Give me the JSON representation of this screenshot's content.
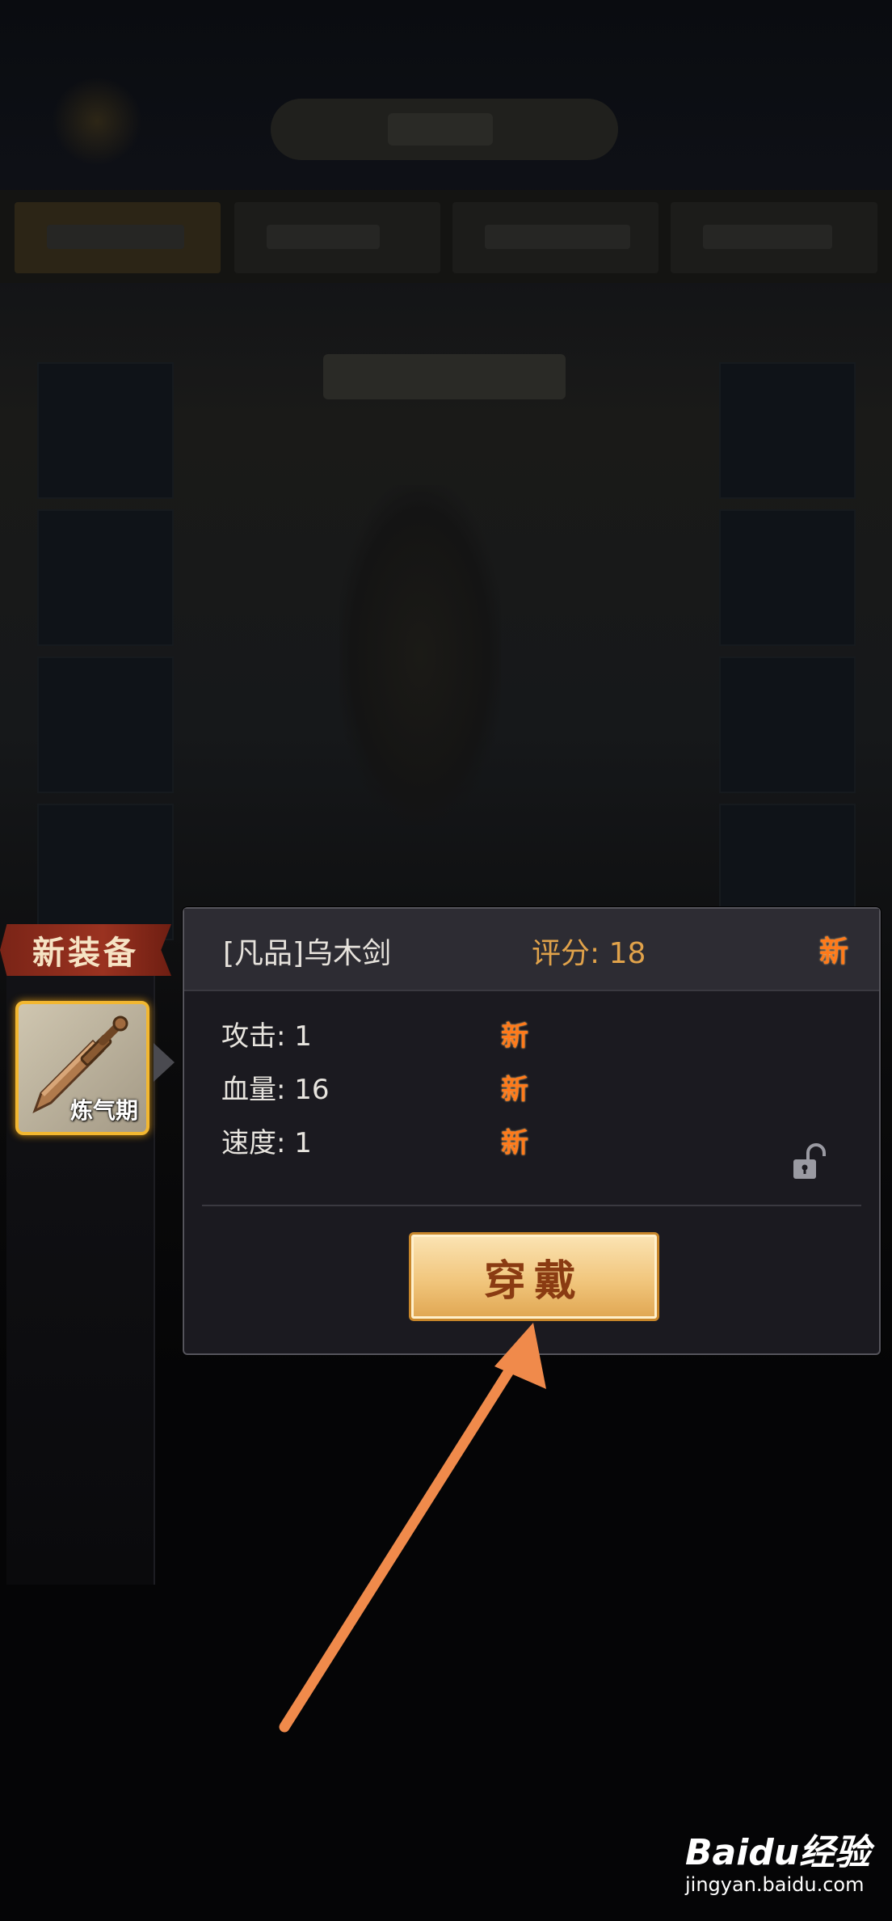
{
  "new_equipment": {
    "label": "新装备",
    "item": {
      "level": "炼气期",
      "icon": "wooden-sword-icon"
    }
  },
  "detail": {
    "name": "[凡品]乌木剑",
    "score": "评分: 18",
    "new_tag": "新",
    "stats": [
      {
        "label": "攻击: 1",
        "tag": "新"
      },
      {
        "label": "血量: 16",
        "tag": "新"
      },
      {
        "label": "速度: 1",
        "tag": "新"
      }
    ],
    "lock_icon": "unlocked-padlock-icon",
    "wear_label": "穿戴"
  },
  "watermark": {
    "brand": "Baidu经验",
    "url": "jingyan.baidu.com"
  },
  "colors": {
    "accent_gold": "#f2b731",
    "new_tag": "#ff7a1a",
    "arrow": "#f08a4b",
    "panel": "#1b1a20"
  }
}
